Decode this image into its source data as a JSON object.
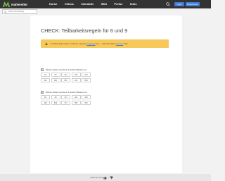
{
  "header": {
    "logo_text": "matheretter",
    "nav": [
      "Kurse",
      "Videos",
      "Interaktiv",
      "Wiki",
      "Preise",
      "Infos"
    ],
    "login_label": "Login",
    "register_label": "Registrieren",
    "brand_color": "#3f7dd6"
  },
  "search": {
    "placeholder": "Suche (Lernthema)"
  },
  "main": {
    "title": "CHECK: Teilbarkeitsregeln für 6 und 9",
    "notice": {
      "before": "Um diese Seite nutzen zu können, musst du ",
      "link1": "eingeloggt",
      "middle": " sein. → Was das? Diese ",
      "link2": "Infoseite",
      "after": " lesen."
    },
    "questions": [
      {
        "number": "1",
        "text": "Welche Zahlen sind durch 6 teilbar? Markiere sie.",
        "cells": [
          "24",
          "50",
          "117",
          "246",
          "270",
          "314",
          "820",
          "581",
          "444",
          "900"
        ]
      },
      {
        "number": "2",
        "text": "Welche Zahlen sind durch 9 teilbar? Markiere sie.",
        "cells": [
          "84",
          "28",
          "171",
          "226",
          "252",
          "104",
          "819",
          "774",
          "785",
          "872"
        ]
      }
    ]
  },
  "footer": {
    "label": "Gefällt dir die Seite?"
  }
}
